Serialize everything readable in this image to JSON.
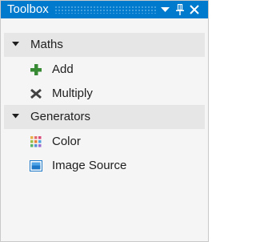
{
  "window": {
    "title": "Toolbox",
    "accent_color": "#007acc",
    "buttons": [
      {
        "name": "dropdown-arrow-icon"
      },
      {
        "name": "pin-icon"
      },
      {
        "name": "close-icon"
      }
    ]
  },
  "groups": [
    {
      "label": "Maths",
      "expanded": true,
      "items": [
        {
          "label": "Add",
          "icon": "plus-icon",
          "icon_color": "#388a34"
        },
        {
          "label": "Multiply",
          "icon": "multiply-icon",
          "icon_color": "#424242"
        }
      ]
    },
    {
      "label": "Generators",
      "expanded": true,
      "items": [
        {
          "label": "Color",
          "icon": "color-palette-icon"
        },
        {
          "label": "Image Source",
          "icon": "image-icon",
          "icon_color": "#1e78c8"
        }
      ]
    }
  ]
}
